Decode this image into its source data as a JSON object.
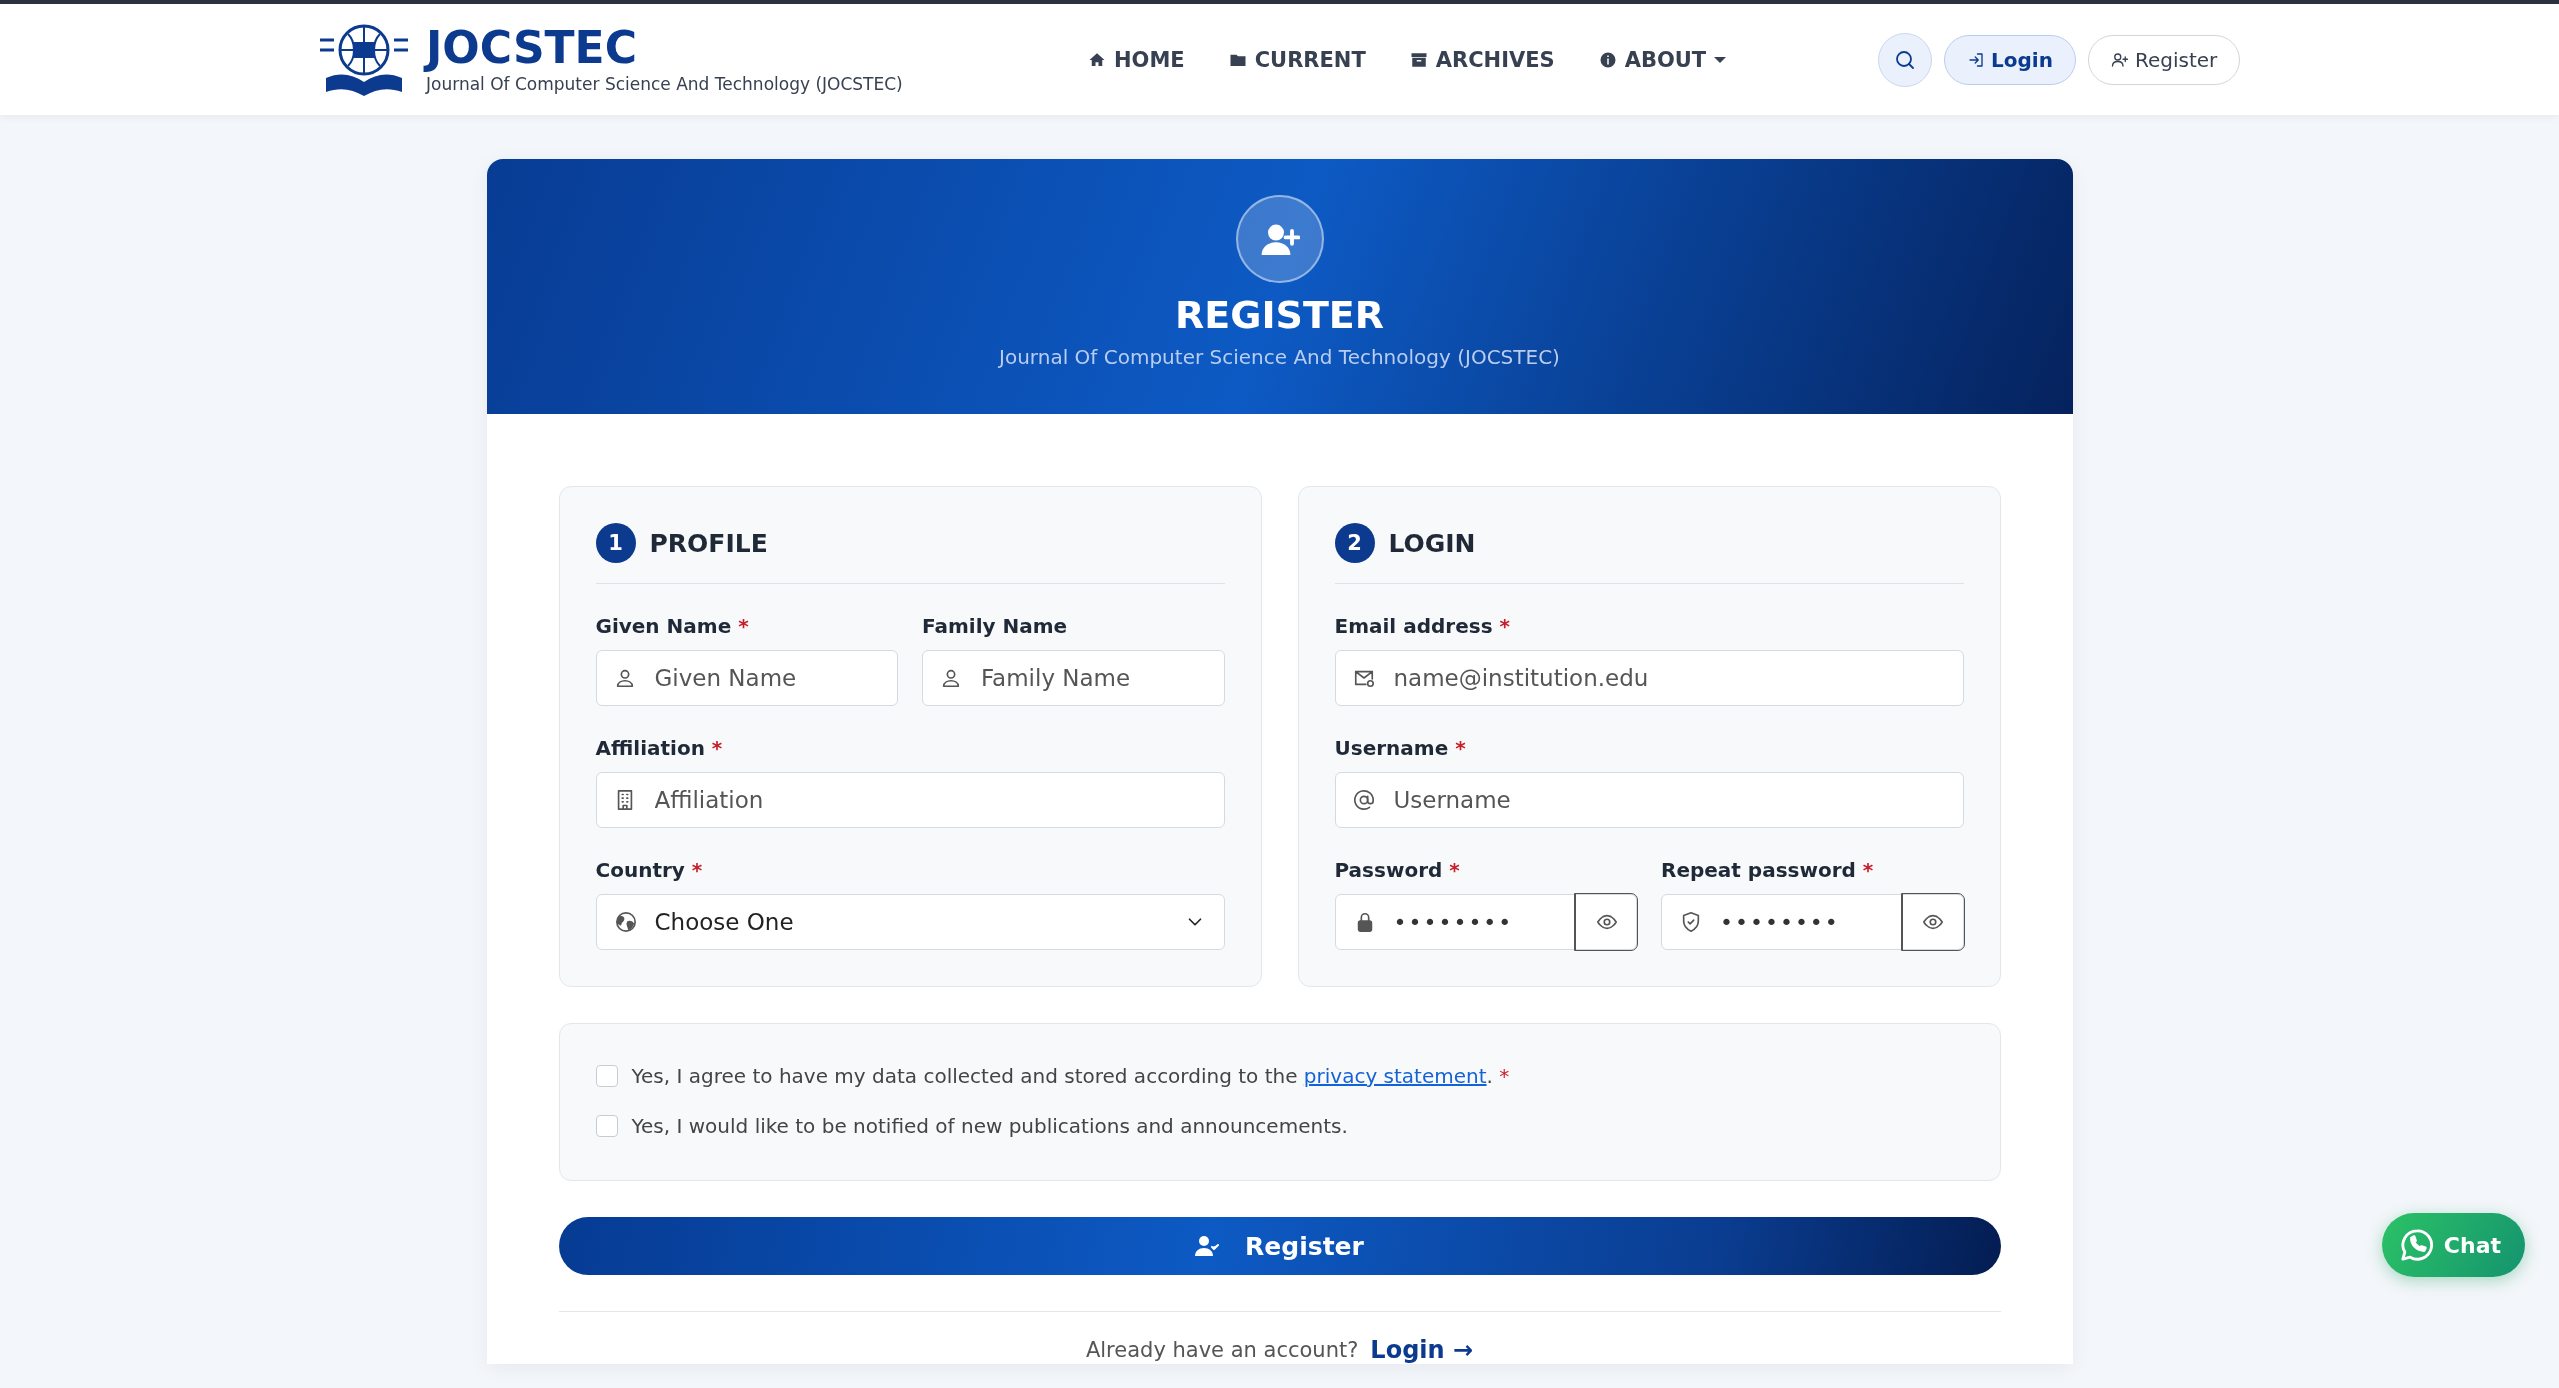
{
  "header": {
    "logo_title": "JOCSTEC",
    "logo_subtitle": "Journal Of Computer Science And Technology (JOCSTEC)",
    "nav": [
      {
        "label": "HOME",
        "dropdown": false
      },
      {
        "label": "CURRENT",
        "dropdown": false
      },
      {
        "label": "ARCHIVES",
        "dropdown": false
      },
      {
        "label": "ABOUT",
        "dropdown": true
      }
    ],
    "actions": [
      {
        "kind": "search"
      },
      {
        "kind": "login",
        "label": "Login"
      },
      {
        "kind": "register",
        "label": "Register"
      }
    ]
  },
  "card": {
    "title": "REGISTER",
    "subtitle": "Journal Of Computer Science And Technology (JOCSTEC)"
  },
  "sections": [
    {
      "number": "1",
      "title": "PROFILE",
      "rows": [
        [
          {
            "label": "Given Name",
            "required_mark": "*",
            "kind": "text",
            "placeholder": "Given Name"
          },
          {
            "label": "Family Name",
            "kind": "text",
            "placeholder": "Family Name"
          }
        ],
        [
          {
            "label": "Affiliation",
            "required_mark": "*",
            "kind": "text",
            "placeholder": "Affiliation"
          }
        ],
        [
          {
            "label": "Country",
            "required_mark": "*",
            "kind": "select",
            "value": "Choose One"
          }
        ]
      ]
    },
    {
      "number": "2",
      "title": "LOGIN",
      "rows": [
        [
          {
            "label": "Email address",
            "required_mark": "*",
            "kind": "text",
            "placeholder": "name@institution.edu"
          }
        ],
        [
          {
            "label": "Username",
            "required_mark": "*",
            "kind": "text",
            "placeholder": "Username"
          }
        ],
        [
          {
            "label": "Password",
            "required_mark": "*",
            "kind": "password",
            "value": "••••••••"
          },
          {
            "label": "Repeat password",
            "required_mark": "*",
            "kind": "password",
            "value": "••••••••"
          }
        ]
      ]
    }
  ],
  "consents": [
    {
      "text_before": "Yes, I agree to have my data collected and stored according to the ",
      "link": "privacy statement",
      "text_after": ".",
      "required_mark": "*",
      "checked": false
    },
    {
      "text_before": "Yes, I would like to be notified of new publications and announcements.",
      "checked": false
    }
  ],
  "submit": "Register",
  "footer": {
    "question": "Already have an account?",
    "link": "Login →"
  },
  "chat": "Chat"
}
